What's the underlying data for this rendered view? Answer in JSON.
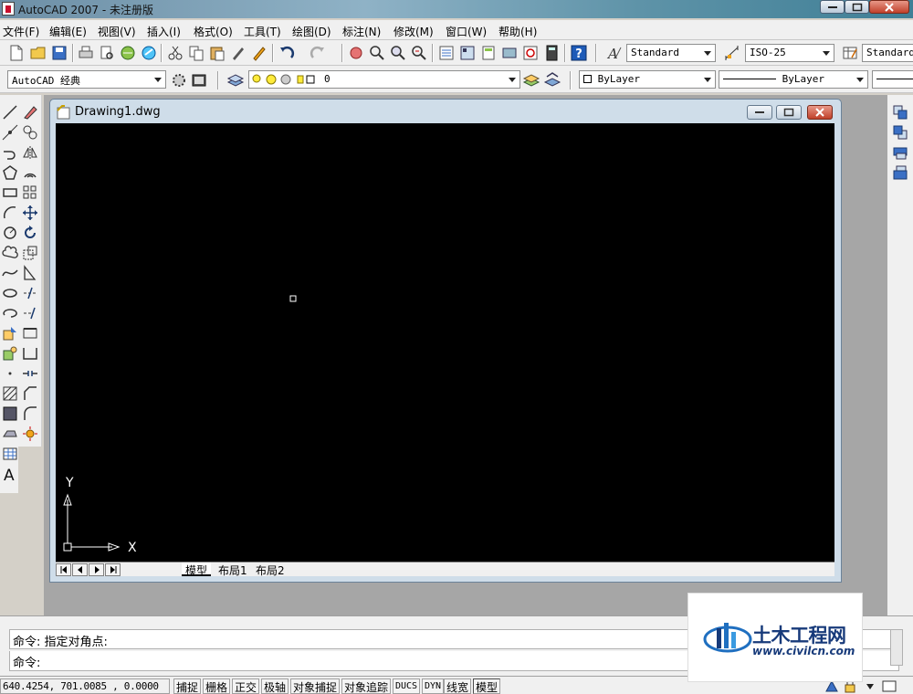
{
  "window": {
    "title": "AutoCAD 2007 - 未注册版"
  },
  "menu": {
    "items": [
      {
        "label": "文件(F)"
      },
      {
        "label": "编辑(E)"
      },
      {
        "label": "视图(V)"
      },
      {
        "label": "插入(I)"
      },
      {
        "label": "格式(O)"
      },
      {
        "label": "工具(T)"
      },
      {
        "label": "绘图(D)"
      },
      {
        "label": "标注(N)"
      },
      {
        "label": "修改(M)"
      },
      {
        "label": "窗口(W)"
      },
      {
        "label": "帮助(H)"
      }
    ]
  },
  "toolbar": {
    "text_style": "Standard",
    "dim_style": "ISO-25",
    "table_style": "Standard",
    "workspace": "AutoCAD 经典",
    "layer": "0",
    "color": "ByLayer",
    "linetype": "ByLayer"
  },
  "drawing": {
    "title": "Drawing1.dwg",
    "ucs": {
      "x_label": "X",
      "y_label": "Y"
    },
    "tabs": [
      {
        "label": "模型"
      },
      {
        "label": "布局1"
      },
      {
        "label": "布局2"
      }
    ]
  },
  "command": {
    "history": "命令: 指定对角点:",
    "prompt": "命令:"
  },
  "status": {
    "coords": "640.4254,  701.0085 , 0.0000",
    "toggles": [
      {
        "label": "捕捉"
      },
      {
        "label": "栅格"
      },
      {
        "label": "正交"
      },
      {
        "label": "极轴"
      },
      {
        "label": "对象捕捉"
      },
      {
        "label": "对象追踪"
      },
      {
        "label": "DUCS"
      },
      {
        "label": "DYN"
      },
      {
        "label": "线宽"
      },
      {
        "label": "模型"
      }
    ]
  },
  "watermark": {
    "name": "土木工程网",
    "url": "www.civilcn.com"
  },
  "colors": {
    "canvas": "#000000",
    "workspace": "#a6a6a6",
    "chrome": "#f0f0f0",
    "brand_blue": "#173a7a"
  }
}
